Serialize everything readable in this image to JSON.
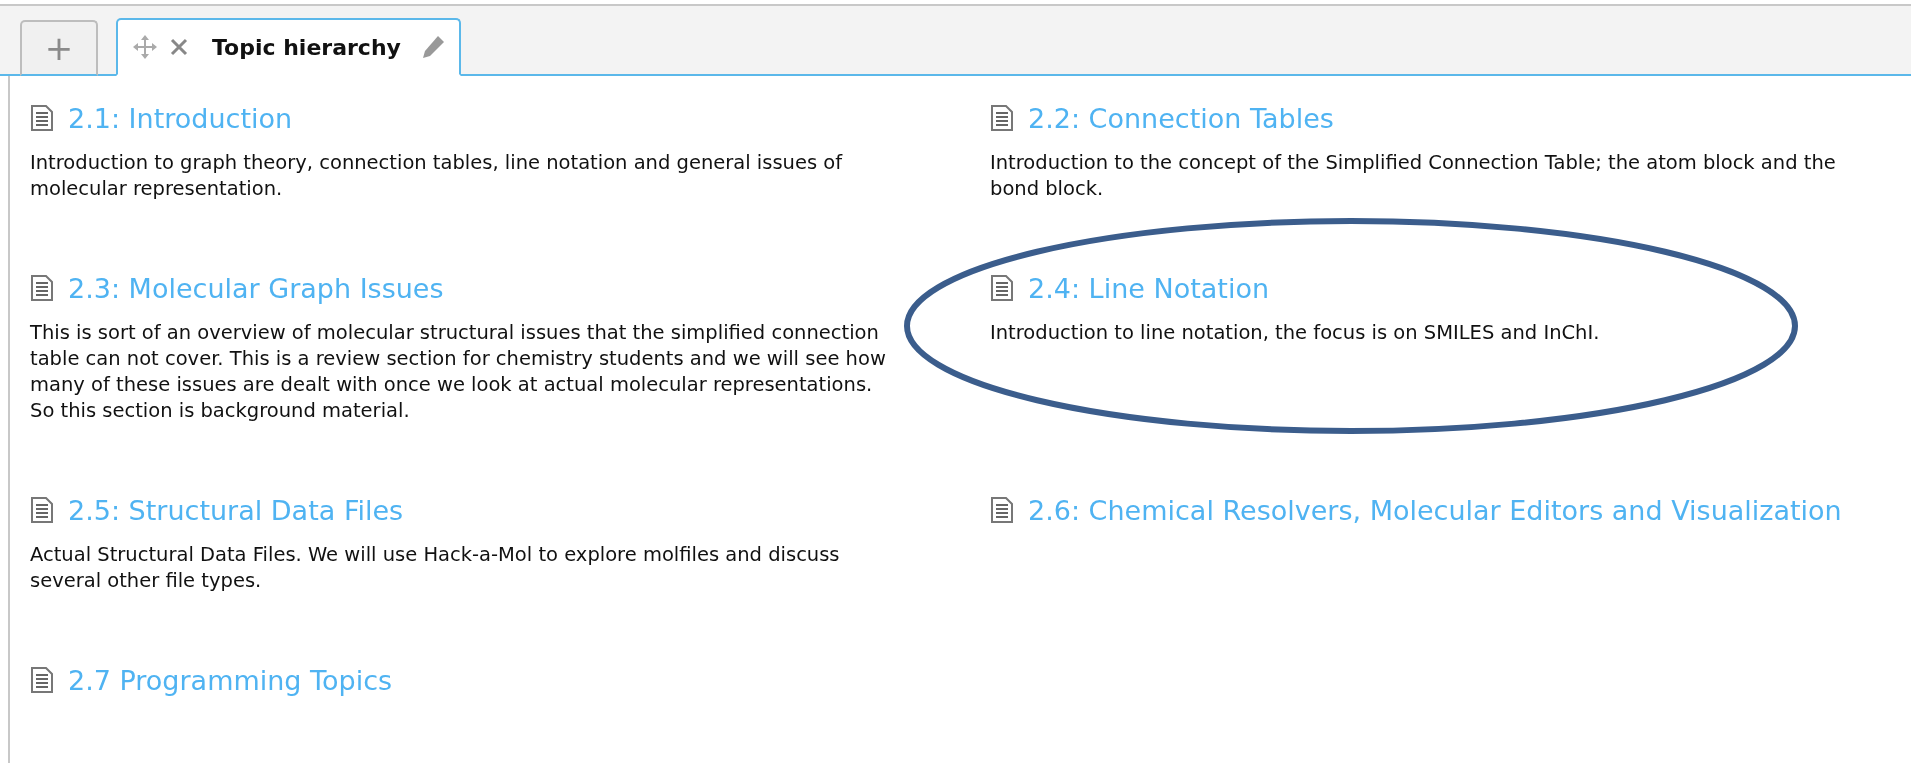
{
  "tabs": [
    {
      "kind": "add",
      "label": "+",
      "selected": false
    },
    {
      "kind": "page",
      "label": "Topic hierarchy",
      "selected": true
    }
  ],
  "topics": [
    {
      "title": "2.1: Introduction",
      "description": "Introduction to graph theory, connection tables, line notation and general issues of molecular representation.",
      "circled": false
    },
    {
      "title": "2.2: Connection Tables",
      "description": "Introduction to the concept of the Simplified Connection Table; the atom block and the bond block.",
      "circled": false
    },
    {
      "title": "2.3: Molecular Graph Issues",
      "description": "This is sort of an overview of molecular structural issues that the simplified connection table can not cover. This is a review section for chemistry students and we will see how many of these issues are dealt with once we look at actual molecular representations.  So this section is background material.",
      "circled": false
    },
    {
      "title": "2.4: Line Notation",
      "description": "Introduction to line notation, the focus is on SMILES and InChI.",
      "circled": true
    },
    {
      "title": "2.5: Structural Data Files",
      "description": "Actual Structural Data Files.  We will use Hack-a-Mol to explore molfiles and discuss several other file types.",
      "circled": false
    },
    {
      "title": "2.6: Chemical Resolvers, Molecular Editors and Visualization",
      "circled": false
    },
    {
      "title": "2.7 Programming Topics",
      "circled": false
    }
  ]
}
